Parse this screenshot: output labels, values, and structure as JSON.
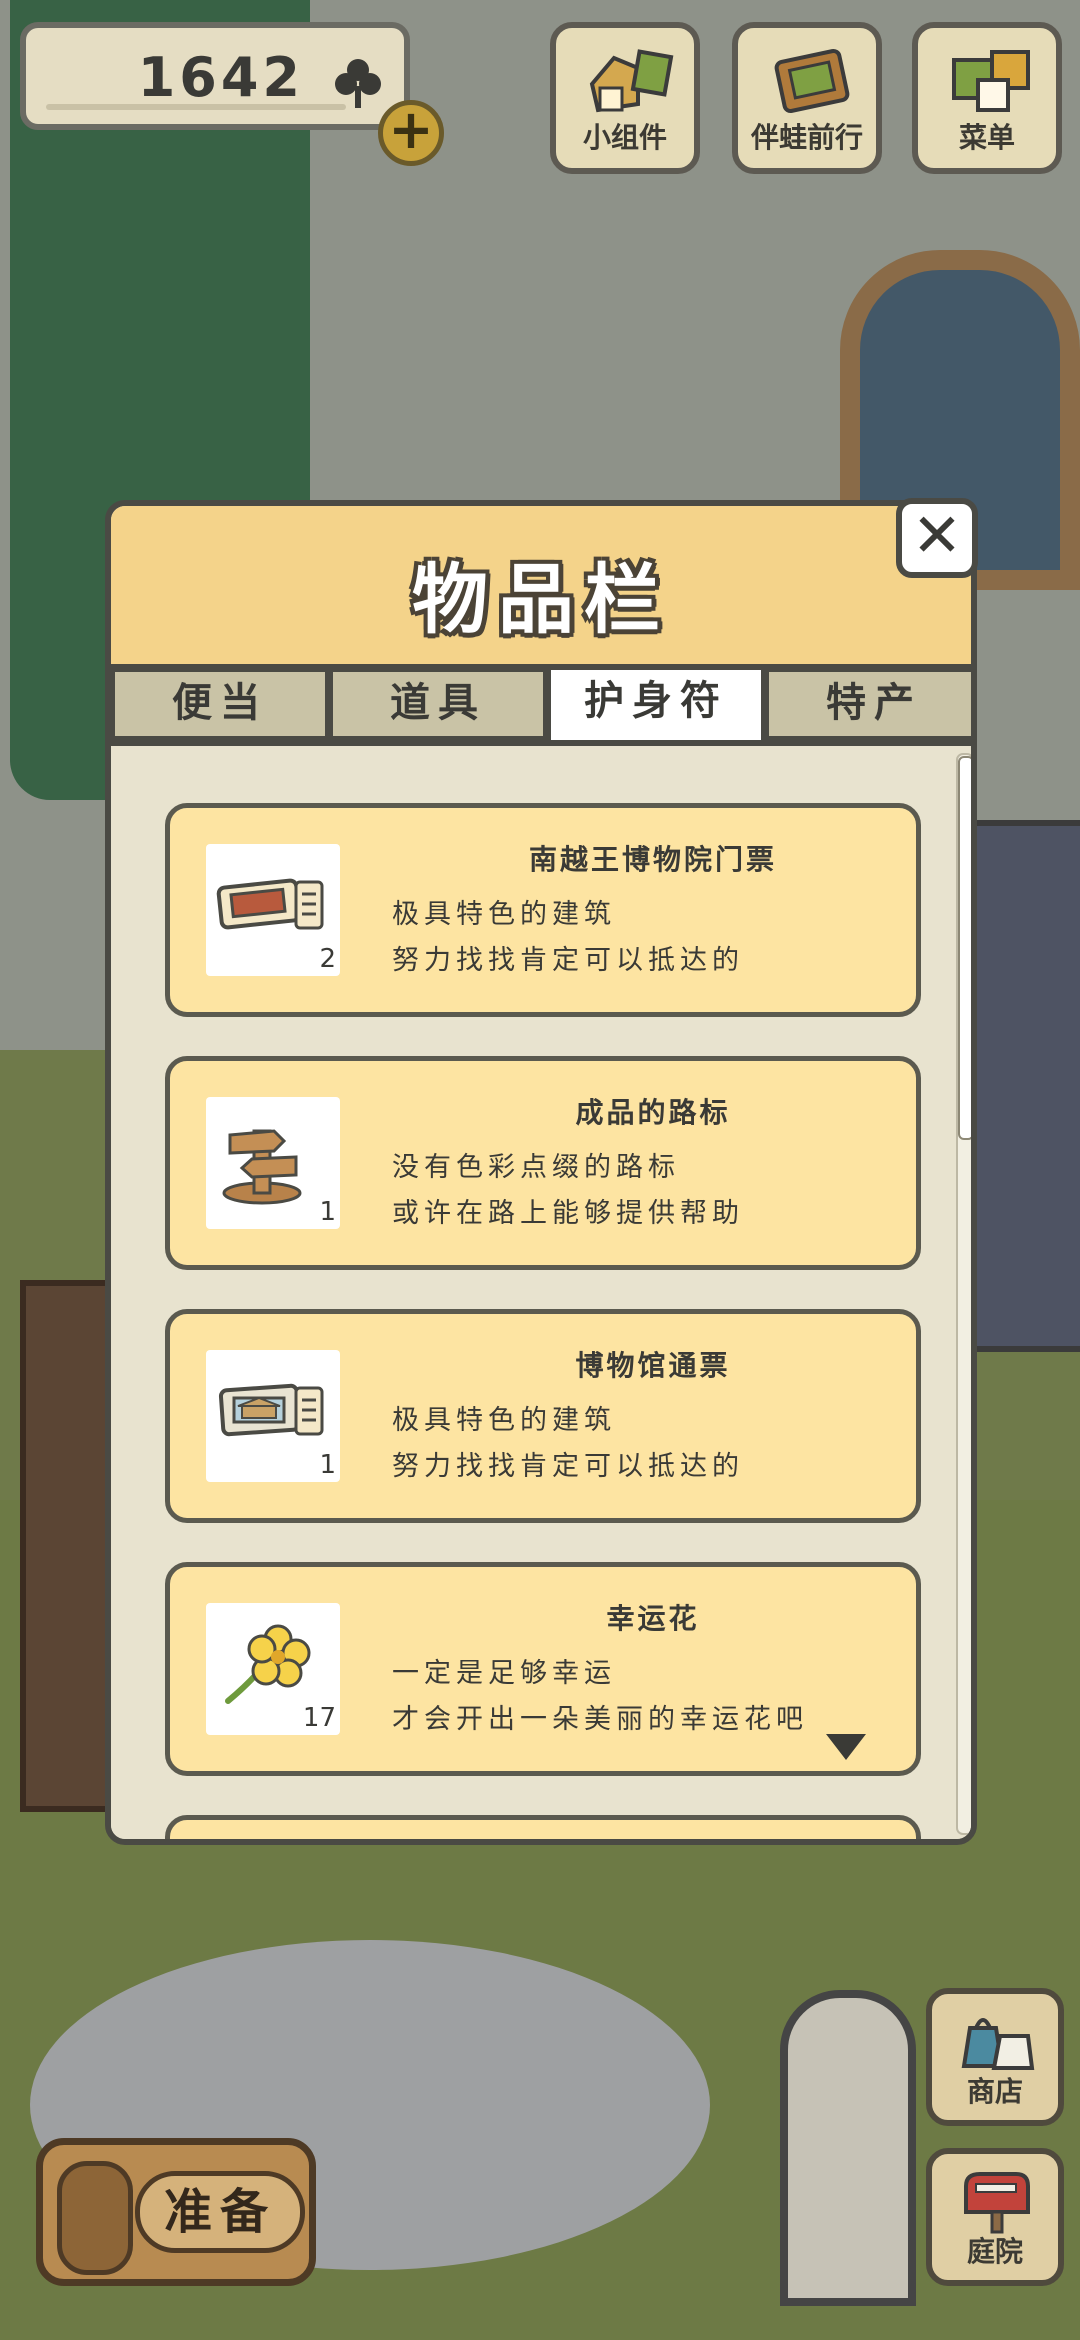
{
  "hud": {
    "coins": "1642",
    "plus": "+",
    "buttons": [
      {
        "label": "小组件",
        "icon": "widget-icon"
      },
      {
        "label": "伴蛙前行",
        "icon": "frog-album-icon"
      },
      {
        "label": "菜单",
        "icon": "menu-icon"
      }
    ]
  },
  "dialog": {
    "title": "物品栏",
    "close": "✕",
    "tabs": [
      "便当",
      "道具",
      "护身符",
      "特产"
    ],
    "active_tab": "护身符",
    "items": [
      {
        "name": "南越王博物院门票",
        "desc1": "极具特色的建筑",
        "desc2": "努力找找肯定可以抵达的",
        "count": "2",
        "icon": "ticket-icon"
      },
      {
        "name": "成品的路标",
        "desc1": "没有色彩点缀的路标",
        "desc2": "或许在路上能够提供帮助",
        "count": "1",
        "icon": "signpost-icon"
      },
      {
        "name": "博物馆通票",
        "desc1": "极具特色的建筑",
        "desc2": "努力找找肯定可以抵达的",
        "count": "1",
        "icon": "museum-ticket-icon"
      },
      {
        "name": "幸运花",
        "desc1": "一定是足够幸运",
        "desc2": "才会开出一朵美丽的幸运花吧",
        "count": "17",
        "icon": "lucky-flower-icon"
      }
    ]
  },
  "bottom": {
    "ready": "准备",
    "shop": "商店",
    "yard": "庭院"
  },
  "colors": {
    "dialog_header": "#f4d38a",
    "item_card": "#fde4a2",
    "border": "#4a4a44",
    "active_tab": "#ffffff"
  }
}
